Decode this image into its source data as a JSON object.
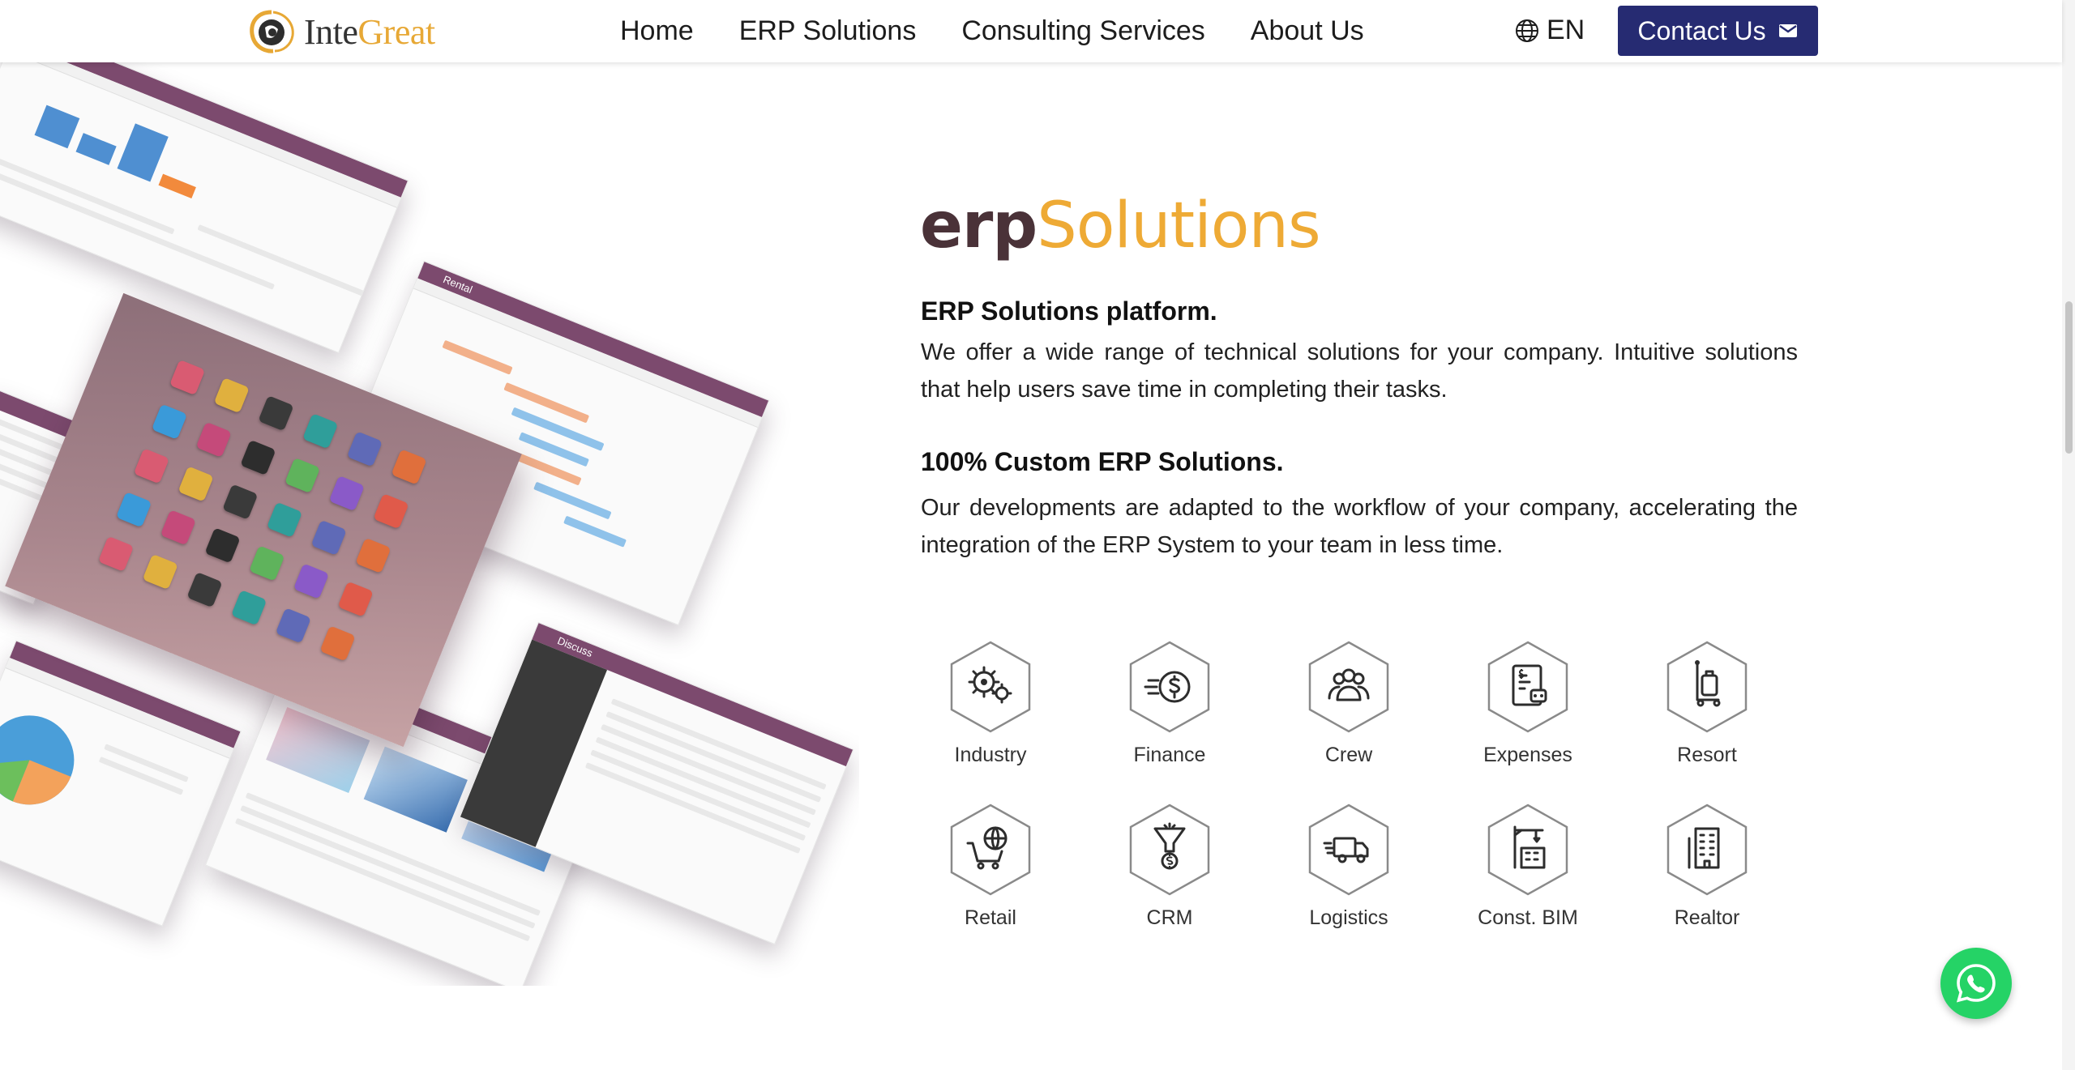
{
  "brand": {
    "name_part1": "Inte",
    "name_part2": "Great"
  },
  "nav": {
    "links": [
      "Home",
      "ERP Solutions",
      "Consulting Services",
      "About Us"
    ],
    "language": "EN",
    "contact_label": "Contact Us"
  },
  "hero": {
    "logo_part1": "erp",
    "logo_part2": "Solutions",
    "sections": [
      {
        "heading": "ERP Solutions platform.",
        "text": "We offer a wide range of technical solutions for your company. Intuitive solutions that help users save time in completing their tasks."
      },
      {
        "heading": "100% Custom ERP Solutions.",
        "text": "Our developments are adapted to the workflow of your company, accelerating the integration of the ERP System to your team in less time."
      }
    ]
  },
  "solutions": [
    {
      "label": "Industry",
      "icon": "gears-icon"
    },
    {
      "label": "Finance",
      "icon": "dollar-coin-icon"
    },
    {
      "label": "Crew",
      "icon": "team-icon"
    },
    {
      "label": "Expenses",
      "icon": "expense-report-icon"
    },
    {
      "label": "Resort",
      "icon": "luggage-cart-icon"
    },
    {
      "label": "Retail",
      "icon": "shopping-cart-globe-icon"
    },
    {
      "label": "CRM",
      "icon": "funnel-dollar-icon"
    },
    {
      "label": "Logistics",
      "icon": "truck-icon"
    },
    {
      "label": "Const. BIM",
      "icon": "crane-building-icon"
    },
    {
      "label": "Realtor",
      "icon": "building-icon"
    }
  ],
  "collage_labels": {
    "rental": "Rental",
    "discuss": "Discuss"
  },
  "colors": {
    "primary": "#262b72",
    "accent": "#eeaa35",
    "odoo_purple": "#7c4a6e",
    "whatsapp": "#25d366"
  }
}
